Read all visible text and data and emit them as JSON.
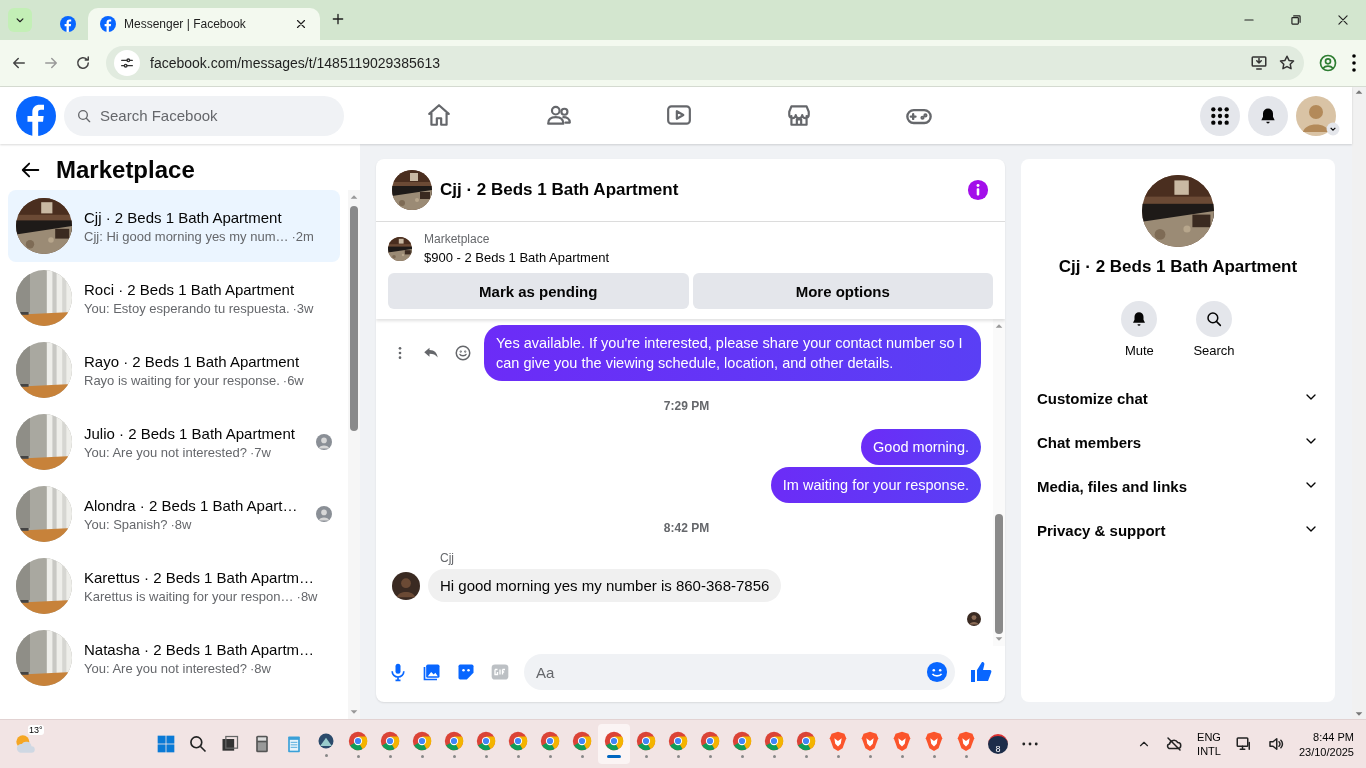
{
  "browser": {
    "tabs": [
      {
        "selected": false
      },
      {
        "title": "Messenger | Facebook",
        "selected": true
      }
    ],
    "url": "facebook.com/messages/t/1485119029385613"
  },
  "header": {
    "search_placeholder": "Search Facebook"
  },
  "sidebar": {
    "title": "Marketplace",
    "conversations": [
      {
        "name": "Cjj · 2 Beds 1 Bath Apartment",
        "preview": "Cjj: Hi good morning yes my num…",
        "time": "·2m",
        "selected": true,
        "read_receipt": false
      },
      {
        "name": "Roci · 2 Beds 1 Bath Apartment",
        "preview": "You: Estoy esperando tu respuesta.",
        "time": "·3w",
        "selected": false,
        "read_receipt": false
      },
      {
        "name": "Rayo · 2 Beds 1 Bath Apartment",
        "preview": "Rayo is waiting for your response.",
        "time": "·6w",
        "selected": false,
        "read_receipt": false
      },
      {
        "name": "Julio · 2 Beds 1 Bath Apartment",
        "preview": "You: Are you not interested?",
        "time": "·7w",
        "selected": false,
        "read_receipt": true
      },
      {
        "name": "Alondra · 2 Beds 1 Bath Apart…",
        "preview": "You: Spanish?",
        "time": "·8w",
        "selected": false,
        "read_receipt": true
      },
      {
        "name": "Karettus · 2 Beds 1 Bath Apartm…",
        "preview": "Karettus is waiting for your respon…",
        "time": "·8w",
        "selected": false,
        "read_receipt": false
      },
      {
        "name": "Natasha · 2 Beds 1 Bath Apartm…",
        "preview": "You: Are you not interested?",
        "time": "·8w",
        "selected": false,
        "read_receipt": false
      }
    ]
  },
  "chat": {
    "title": "Cjj · 2 Beds 1 Bath Apartment",
    "listing": {
      "source": "Marketplace",
      "title": "$900 - 2 Beds 1 Bath Apartment",
      "buttons": [
        "Mark as pending",
        "More options"
      ]
    },
    "messages": [
      {
        "kind": "outgoing",
        "text": "Yes available. If you're interested, please share your contact number so I can give you the viewing schedule, location, and other details.",
        "hovered": true
      },
      {
        "kind": "time",
        "text": "7:29 PM"
      },
      {
        "kind": "outgoing",
        "text": "Good morning.",
        "hovered": false
      },
      {
        "kind": "outgoing",
        "text": "Im waiting for your response.",
        "hovered": false
      },
      {
        "kind": "time",
        "text": "8:42 PM"
      },
      {
        "kind": "incoming",
        "sender": "Cjj",
        "text": "Hi good morning yes my number is 860-368-7856"
      }
    ],
    "seen": true,
    "composer": {
      "placeholder": "Aa"
    }
  },
  "details": {
    "title": "Cjj · 2 Beds 1 Bath Apartment",
    "actions": [
      {
        "kind": "mute",
        "label": "Mute"
      },
      {
        "kind": "search",
        "label": "Search"
      }
    ],
    "sections": [
      {
        "label": "Customize chat",
        "expanded": false
      },
      {
        "label": "Chat members",
        "expanded": false
      },
      {
        "label": "Media, files and links",
        "expanded": false
      },
      {
        "label": "Privacy & support",
        "expanded": false
      }
    ]
  },
  "taskbar": {
    "weather": "13°",
    "apps": [
      {
        "kind": "start",
        "selected": false
      },
      {
        "kind": "search",
        "selected": false
      },
      {
        "kind": "taskview",
        "selected": false
      },
      {
        "kind": "calculator",
        "selected": false
      },
      {
        "kind": "notepad",
        "selected": false
      },
      {
        "kind": "app",
        "selected": false,
        "running": true
      },
      {
        "kind": "chrome",
        "selected": false,
        "running": true
      },
      {
        "kind": "chrome",
        "selected": false,
        "running": true
      },
      {
        "kind": "chrome",
        "selected": false,
        "running": true
      },
      {
        "kind": "chrome",
        "selected": false,
        "running": true
      },
      {
        "kind": "chrome",
        "selected": false,
        "running": true
      },
      {
        "kind": "chrome",
        "selected": false,
        "running": true
      },
      {
        "kind": "chrome",
        "selected": false,
        "running": true
      },
      {
        "kind": "chrome",
        "selected": false,
        "running": true
      },
      {
        "kind": "chrome",
        "selected": true,
        "running": true
      },
      {
        "kind": "chrome",
        "selected": false,
        "running": true
      },
      {
        "kind": "chrome",
        "selected": false,
        "running": true
      },
      {
        "kind": "chrome",
        "selected": false,
        "running": true
      },
      {
        "kind": "chrome",
        "selected": false,
        "running": true
      },
      {
        "kind": "chrome",
        "selected": false,
        "running": true
      },
      {
        "kind": "chrome",
        "selected": false,
        "running": true
      },
      {
        "kind": "brave",
        "selected": false,
        "running": true
      },
      {
        "kind": "brave",
        "selected": false,
        "running": true
      },
      {
        "kind": "brave",
        "selected": false,
        "running": true
      },
      {
        "kind": "brave",
        "selected": false,
        "running": true
      },
      {
        "kind": "brave",
        "selected": false,
        "running": true
      },
      {
        "kind": "gauge",
        "badge": "8",
        "selected": false
      },
      {
        "kind": "more",
        "selected": false
      }
    ],
    "language": "ENG",
    "layout": "INTL",
    "time": "8:44 PM",
    "date": "23/10/2025"
  }
}
